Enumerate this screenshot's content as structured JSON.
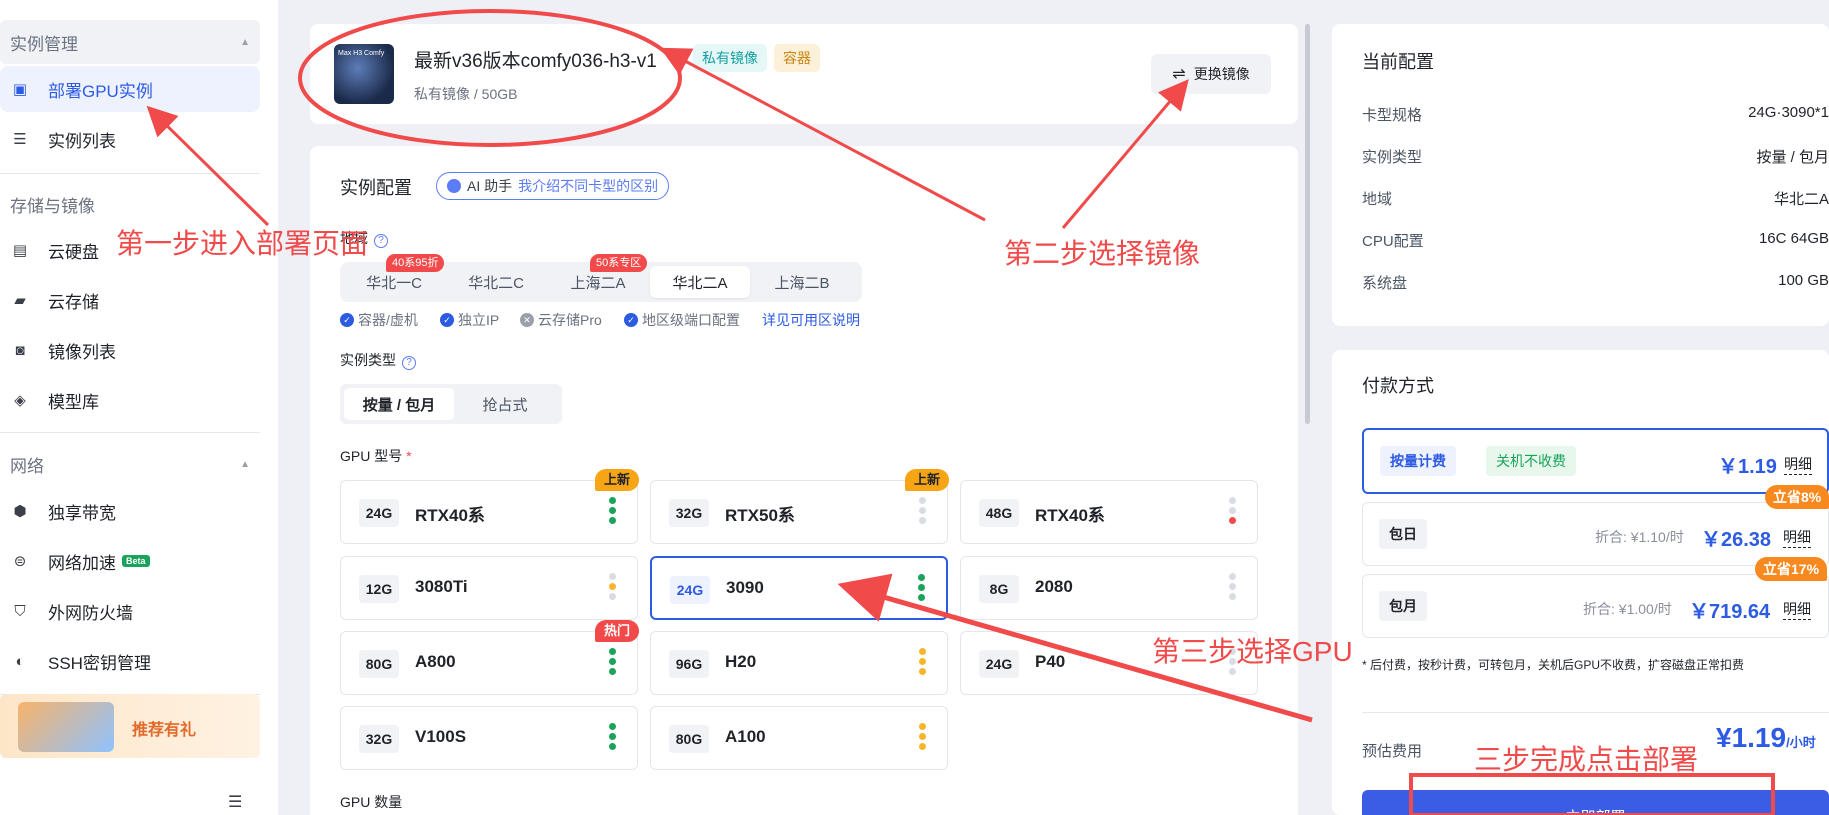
{
  "sidebar": {
    "sections": [
      {
        "title": "实例管理"
      },
      {
        "title": "存储与镜像"
      },
      {
        "title": "网络"
      }
    ],
    "items": [
      {
        "label": "部署GPU实例",
        "icon": "deploy-icon"
      },
      {
        "label": "实例列表",
        "icon": "list-icon"
      },
      {
        "label": "云硬盘",
        "icon": "disk-icon"
      },
      {
        "label": "云存储",
        "icon": "folder-icon"
      },
      {
        "label": "镜像列表",
        "icon": "image-icon"
      },
      {
        "label": "模型库",
        "icon": "cube-icon"
      },
      {
        "label": "独享带宽",
        "icon": "bandwidth-icon"
      },
      {
        "label": "网络加速",
        "icon": "accelerate-icon"
      },
      {
        "label": "外网防火墙",
        "icon": "shield-icon"
      },
      {
        "label": "SSH密钥管理",
        "icon": "key-icon"
      }
    ],
    "beta": "Beta",
    "promo": "推荐有礼"
  },
  "image_card": {
    "title": "最新v36版本comfy036-h3-v1",
    "subtitle": "私有镜像 / 50GB",
    "tag_private": "私有镜像",
    "tag_container": "容器",
    "switch_button": "更换镜像",
    "thumb_text": "Max H3 Comfy"
  },
  "config": {
    "title": "实例配置",
    "ai_label": "AI 助手",
    "ai_link": "我介绍不同卡型的区别",
    "region_label": "地域",
    "regions": [
      {
        "label": "华北一C",
        "badge": "40系95折"
      },
      {
        "label": "华北二C",
        "badge": ""
      },
      {
        "label": "上海二A",
        "badge": "50系专区"
      },
      {
        "label": "华北二A",
        "badge": ""
      },
      {
        "label": "上海二B",
        "badge": ""
      }
    ],
    "features": [
      "容器/虚机",
      "独立IP",
      "云存储Pro",
      "地区级端口配置"
    ],
    "features_link": "详见可用区说明",
    "type_label": "实例类型",
    "types": [
      "按量 / 包月",
      "抢占式"
    ],
    "gpu_label": "GPU 型号",
    "gpu_required": "*",
    "gpus": [
      {
        "mem": "24G",
        "name": "RTX40系",
        "badge": "上新"
      },
      {
        "mem": "32G",
        "name": "RTX50系",
        "badge": "上新"
      },
      {
        "mem": "48G",
        "name": "RTX40系",
        "badge": ""
      },
      {
        "mem": "12G",
        "name": "3080Ti",
        "badge": ""
      },
      {
        "mem": "24G",
        "name": "3090",
        "badge": ""
      },
      {
        "mem": "8G",
        "name": "2080",
        "badge": ""
      },
      {
        "mem": "80G",
        "name": "A800",
        "badge": "热门"
      },
      {
        "mem": "96G",
        "name": "H20",
        "badge": ""
      },
      {
        "mem": "24G",
        "name": "P40",
        "badge": ""
      },
      {
        "mem": "32G",
        "name": "V100S",
        "badge": ""
      },
      {
        "mem": "80G",
        "name": "A100",
        "badge": ""
      }
    ],
    "gpu_count_label": "GPU 数量"
  },
  "current_config": {
    "title": "当前配置",
    "rows": [
      {
        "k": "卡型规格",
        "v": "24G·3090*1"
      },
      {
        "k": "实例类型",
        "v": "按量 / 包月"
      },
      {
        "k": "地域",
        "v": "华北二A"
      },
      {
        "k": "CPU配置",
        "v": "16C 64GB"
      },
      {
        "k": "系统盘",
        "v": "100 GB"
      }
    ]
  },
  "payment": {
    "title": "付款方式",
    "options": [
      {
        "tag": "按量计费",
        "tag2": "关机不收费",
        "discount": "",
        "price": "￥1.19",
        "detail": "明细",
        "save": ""
      },
      {
        "tag": "包日",
        "tag2": "",
        "discount": "折合: ¥1.10/时",
        "price": "￥26.38",
        "detail": "明细",
        "save": "立省8%"
      },
      {
        "tag": "包月",
        "tag2": "",
        "discount": "折合: ¥1.00/时",
        "price": "￥719.64",
        "detail": "明细",
        "save": "立省17%"
      }
    ],
    "note": "* 后付费，按秒计费，可转包月，关机后GPU不收费，扩容磁盘正常扣费",
    "estimate_label": "预估费用",
    "estimate_value": "¥1.19",
    "estimate_unit": "/小时",
    "deploy_button": "立即部署"
  },
  "annotations": {
    "step1": "第一步进入部署页面",
    "step2": "第二步选择镜像",
    "step3": "第三步选择GPU",
    "step4": "三步完成点击部署"
  },
  "colors": {
    "accent": "#2d5be3",
    "annotation": "#f04a4a"
  }
}
